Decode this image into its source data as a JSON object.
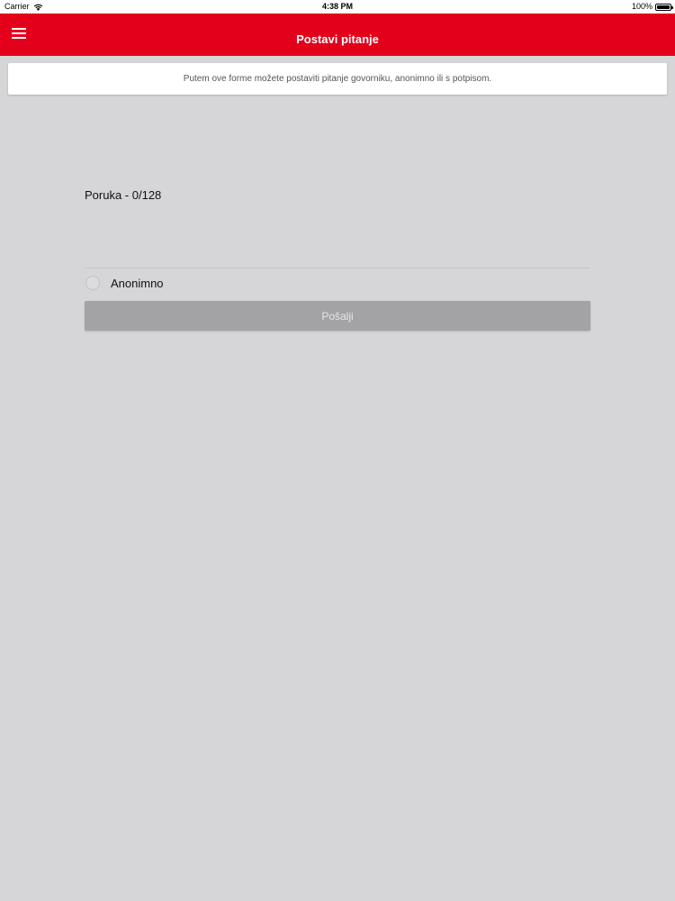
{
  "status_bar": {
    "carrier": "Carrier",
    "time": "4:38 PM",
    "battery": "100%",
    "icons": [
      "wifi-icon",
      "battery-icon"
    ]
  },
  "nav": {
    "title": "Postavi pitanje",
    "menu_icon": "hamburger-menu-icon",
    "color": "#e3001b"
  },
  "info": {
    "text": "Putem ove forme možete postaviti pitanje govorniku, anonimno ili s potpisom."
  },
  "form": {
    "message_label": "Poruka - 0/128",
    "message_value": "",
    "anonymous_label": "Anonimno",
    "anonymous_checked": false,
    "send_label": "Pošalji",
    "send_enabled": false
  }
}
